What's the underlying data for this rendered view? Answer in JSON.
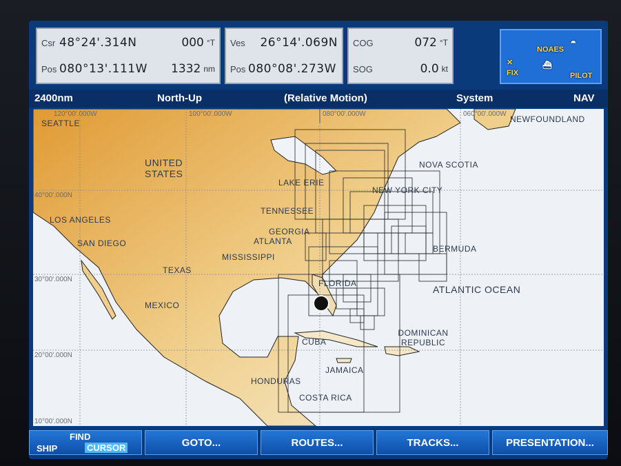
{
  "data_panel": {
    "csr_label": "Csr",
    "csr_lat": "48°24'.314N",
    "csr_bearing": "000",
    "csr_bearing_unit": "°T",
    "pos_label": "Pos",
    "csr_lon": "080°13'.111W",
    "csr_range": "1332",
    "csr_range_unit": "nm",
    "ves_label": "Ves",
    "ves_lat": "26°14'.069N",
    "ves_pos_label": "Pos",
    "ves_lon": "080°08'.273W",
    "cog_label": "COG",
    "cog_value": "072",
    "cog_unit": "°T",
    "sog_label": "SOG",
    "sog_value": "0.0",
    "sog_unit": "kt"
  },
  "fix_panel": {
    "fix_label": "FIX",
    "noaes_label": "NOAES",
    "pilot_label": "PILOT"
  },
  "status_bar": {
    "range": "2400nm",
    "orientation": "North-Up",
    "motion": "(Relative Motion)",
    "system": "System",
    "nav": "NAV"
  },
  "map": {
    "colors": {
      "land": "#e6ad55",
      "land_light": "#f4e8c8",
      "water": "#f0f4f8"
    },
    "coord_labels": {
      "lon120": "120°00'.000W",
      "lon100": "100°00'.000W",
      "lon080": "080°00'.000W",
      "lon060": "060°00'.000W",
      "lat40": "40°00'.000N",
      "lat30": "30°00'.000N",
      "lat20": "20°00'.000N",
      "lat10": "10°00'.000N"
    },
    "place_labels": {
      "seattle": "SEATTLE",
      "united_states": "UNITED STATES",
      "los_angeles": "LOS ANGELES",
      "san_diego": "SAN DIEGO",
      "texas": "TEXAS",
      "mexico": "MEXICO",
      "mississippi": "MISSISSIPPI",
      "georgia": "GEORGIA",
      "atlanta": "ATLANTA",
      "tennessee": "TENNESSEE",
      "lake_erie": "LAKE ERIE",
      "newfoundland": "NEWFOUNDLAND",
      "nova_scotia": "NOVA SCOTIA",
      "new_york_city": "NEW YORK CITY",
      "bermuda": "BERMUDA",
      "atlantic_ocean": "ATLANTIC OCEAN",
      "florida": "FLORIDA",
      "cuba": "CUBA",
      "dominican_republic": "DOMINICAN REPUBLIC",
      "jamaica": "JAMAICA",
      "honduras": "HONDURAS",
      "costa_rica": "COSTA RICA"
    }
  },
  "softkeys": {
    "find": "FIND",
    "ship": "SHIP",
    "cursor": "CURSOR",
    "goto": "GOTO...",
    "routes": "ROUTES...",
    "tracks": "TRACKS...",
    "presentation": "PRESENTATION..."
  }
}
